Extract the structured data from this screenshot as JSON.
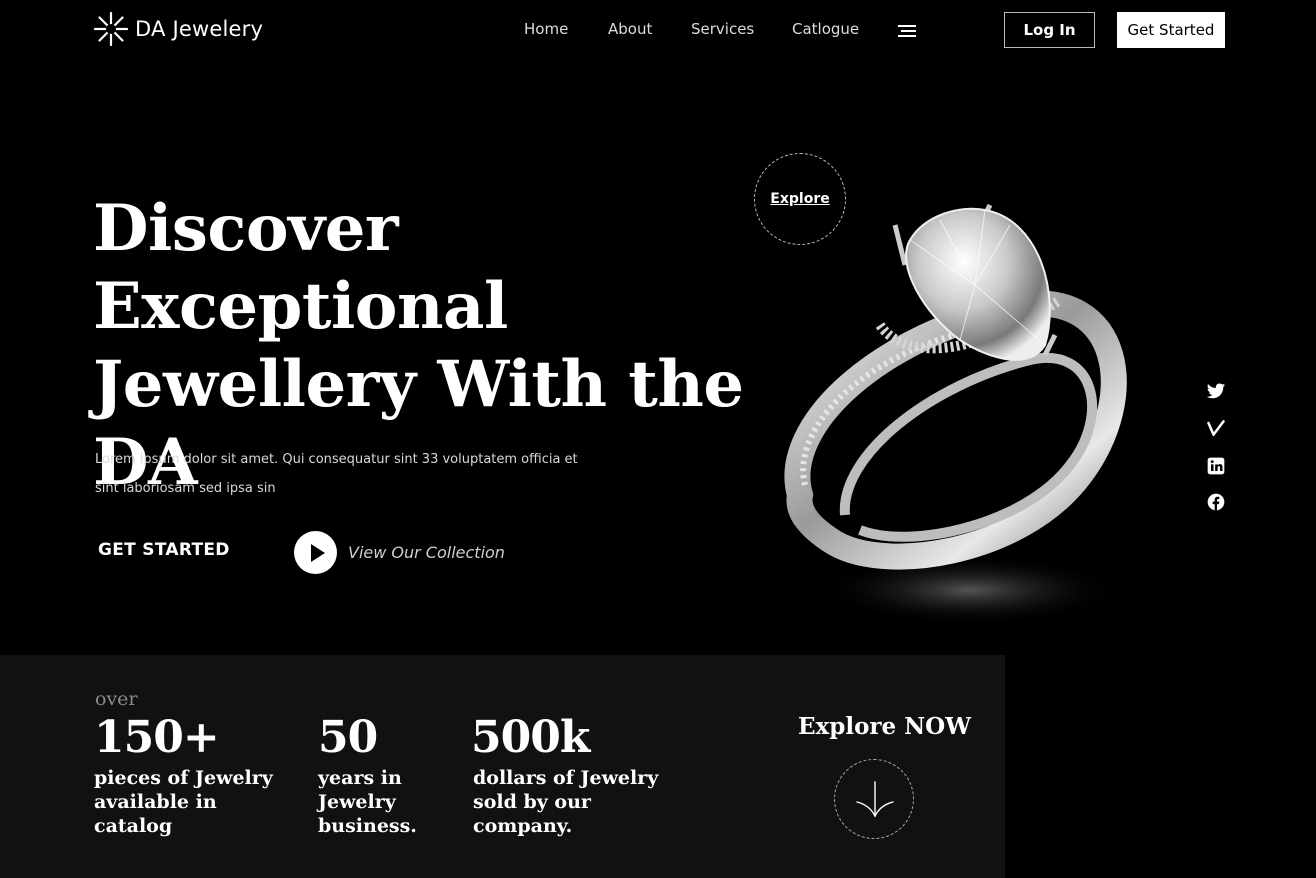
{
  "brand": {
    "name": "DA Jewelery"
  },
  "nav": {
    "links": [
      "Home",
      "About",
      "Services",
      "Catlogue"
    ],
    "login_label": "Log In",
    "get_started_label": "Get Started"
  },
  "hero": {
    "headline_line1": "Discover Exceptional",
    "headline_line2": "Jewellery With the",
    "headline_line3": "DA",
    "lead": "Lorem ipsum dolor sit amet. Qui consequatur sint 33 voluptatem officia et sint laboriosam sed ipsa sin",
    "cta_label": "GET STARTED",
    "collection_label": "View Our Collection",
    "explore_label": "Explore"
  },
  "stats": {
    "prefix": "over",
    "items": [
      {
        "value": "150+",
        "line1": "pieces of Jewelry",
        "line2": "available in",
        "line3": "catalog"
      },
      {
        "value": "50",
        "line1": "years in",
        "line2": "Jewelry",
        "line3": "business."
      },
      {
        "value": "500k",
        "line1": "dollars of Jewelry",
        "line2": "sold by our",
        "line3": "company."
      }
    ],
    "explore_now": "Explore NOW"
  },
  "colors": {
    "background": "#000000",
    "panel": "#111111",
    "text": "#ffffff"
  },
  "icons": [
    "sparkle-logo-icon",
    "menu-icon",
    "play-icon",
    "twitter-icon",
    "vimeo-icon",
    "linkedin-icon",
    "facebook-icon",
    "arrow-down-icon"
  ]
}
